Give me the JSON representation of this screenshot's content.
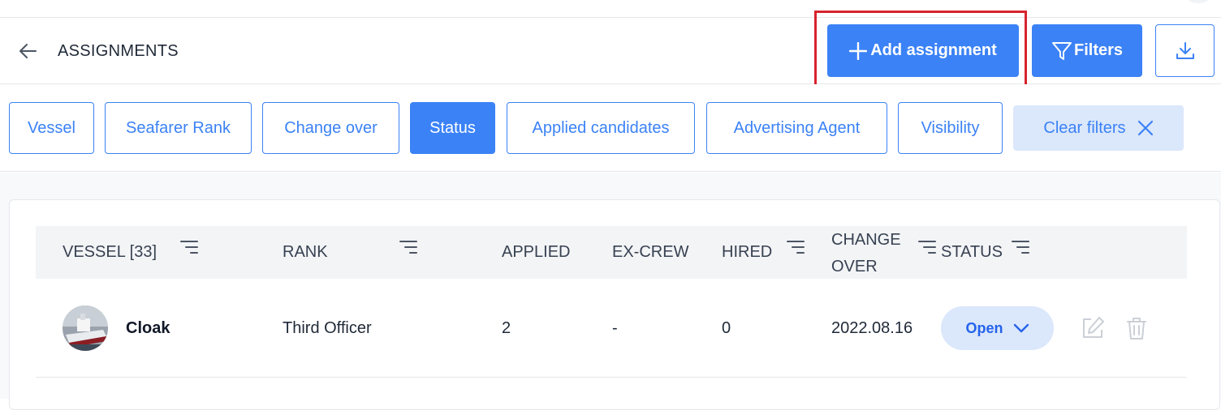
{
  "header": {
    "title": "ASSIGNMENTS",
    "add_label": "Add assignment",
    "filters_label": "Filters"
  },
  "filter_chips": [
    {
      "label": "Vessel",
      "active": false
    },
    {
      "label": "Seafarer Rank",
      "active": false
    },
    {
      "label": "Change over",
      "active": false
    },
    {
      "label": "Status",
      "active": true
    },
    {
      "label": "Applied candidates",
      "active": false
    },
    {
      "label": "Advertising Agent",
      "active": false
    },
    {
      "label": "Visibility",
      "active": false
    }
  ],
  "clear_filters_label": "Clear filters",
  "table": {
    "columns": {
      "vessel": "VESSEL [33]",
      "rank": "RANK",
      "applied": "APPLIED",
      "ex_crew": "EX-CREW",
      "hired": "HIRED",
      "change_over_1": "CHANGE",
      "change_over_2": "OVER",
      "status": "STATUS"
    },
    "rows": [
      {
        "vessel": "Cloak",
        "rank": "Third Officer",
        "applied": "2",
        "ex_crew": "-",
        "hired": "0",
        "change_over": "2022.08.16",
        "status": "Open"
      }
    ]
  },
  "colors": {
    "primary": "#3b82f6",
    "highlight": "#d7232d",
    "chip_light": "#dbe7fb"
  }
}
